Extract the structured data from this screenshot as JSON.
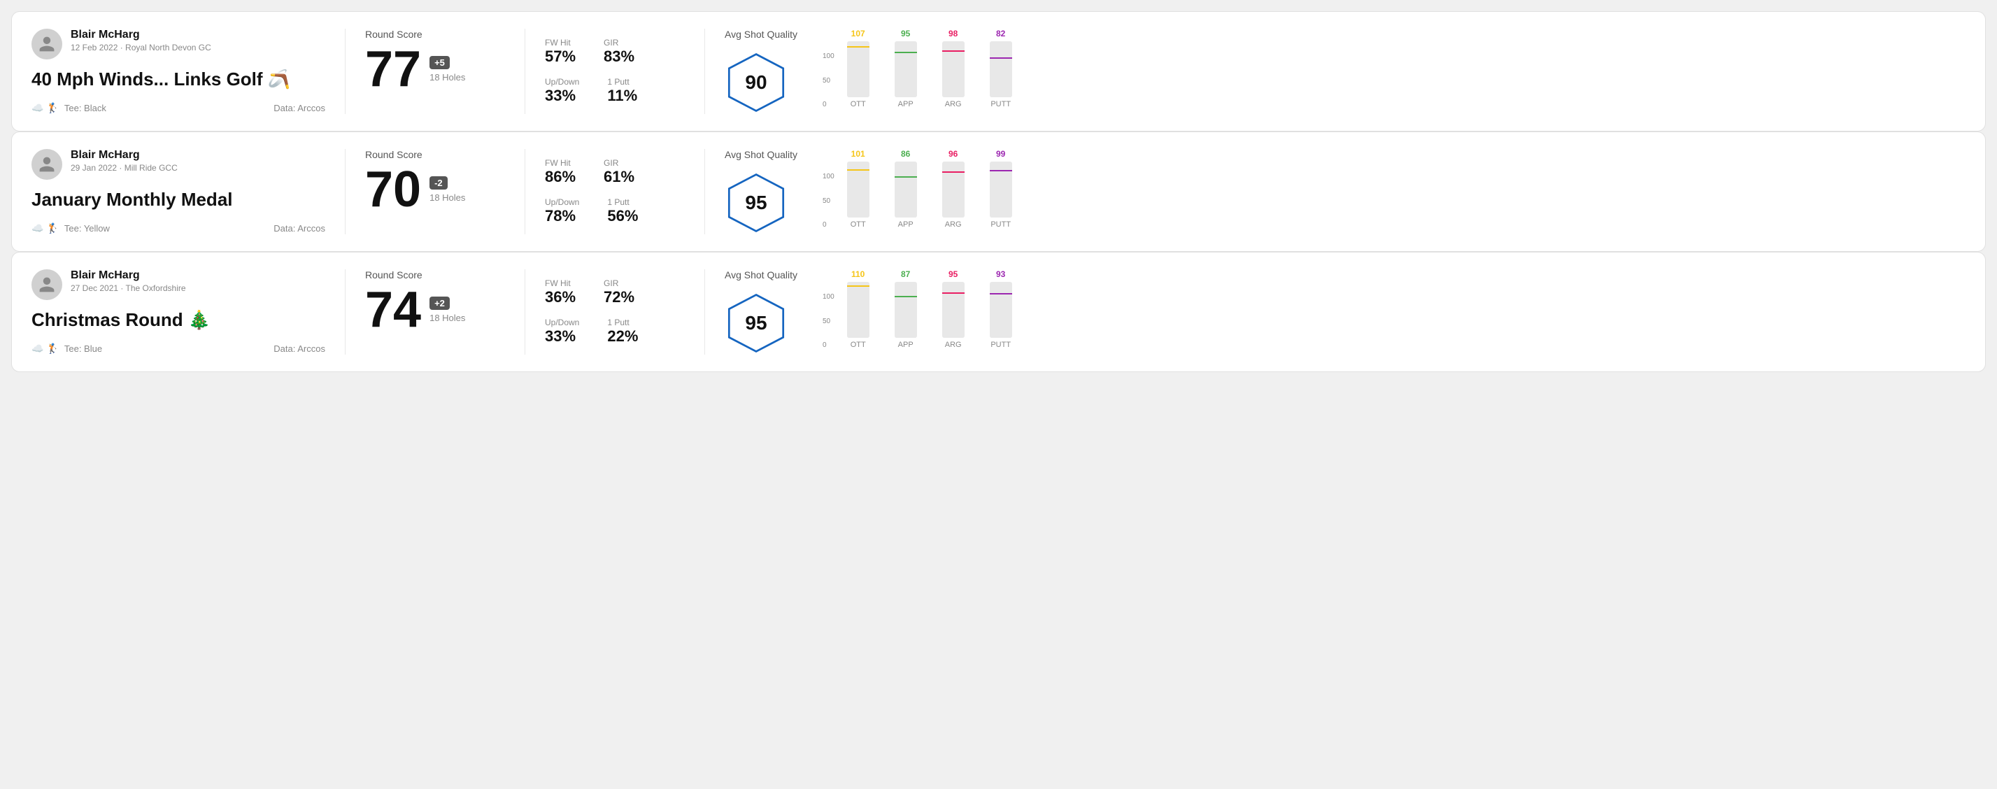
{
  "rounds": [
    {
      "player": "Blair McHarg",
      "date": "12 Feb 2022 · Royal North Devon GC",
      "title": "40 Mph Winds... Links Golf 🪃",
      "tee": "Black",
      "dataSource": "Data: Arccos",
      "score": "77",
      "scoreDiff": "+5",
      "holes": "18 Holes",
      "fwHit": "57%",
      "gir": "83%",
      "upDown": "33%",
      "onePutt": "11%",
      "avgShotQuality": "90",
      "chart": {
        "ott": {
          "value": 107,
          "color": "#f5c518"
        },
        "app": {
          "value": 95,
          "color": "#4caf50"
        },
        "arg": {
          "value": 98,
          "color": "#e91e63"
        },
        "putt": {
          "value": 82,
          "color": "#9c27b0"
        }
      }
    },
    {
      "player": "Blair McHarg",
      "date": "29 Jan 2022 · Mill Ride GCC",
      "title": "January Monthly Medal",
      "tee": "Yellow",
      "dataSource": "Data: Arccos",
      "score": "70",
      "scoreDiff": "-2",
      "holes": "18 Holes",
      "fwHit": "86%",
      "gir": "61%",
      "upDown": "78%",
      "onePutt": "56%",
      "avgShotQuality": "95",
      "chart": {
        "ott": {
          "value": 101,
          "color": "#f5c518"
        },
        "app": {
          "value": 86,
          "color": "#4caf50"
        },
        "arg": {
          "value": 96,
          "color": "#e91e63"
        },
        "putt": {
          "value": 99,
          "color": "#9c27b0"
        }
      }
    },
    {
      "player": "Blair McHarg",
      "date": "27 Dec 2021 · The Oxfordshire",
      "title": "Christmas Round 🎄",
      "tee": "Blue",
      "dataSource": "Data: Arccos",
      "score": "74",
      "scoreDiff": "+2",
      "holes": "18 Holes",
      "fwHit": "36%",
      "gir": "72%",
      "upDown": "33%",
      "onePutt": "22%",
      "avgShotQuality": "95",
      "chart": {
        "ott": {
          "value": 110,
          "color": "#f5c518"
        },
        "app": {
          "value": 87,
          "color": "#4caf50"
        },
        "arg": {
          "value": 95,
          "color": "#e91e63"
        },
        "putt": {
          "value": 93,
          "color": "#9c27b0"
        }
      }
    }
  ],
  "labels": {
    "roundScore": "Round Score",
    "fwHit": "FW Hit",
    "gir": "GIR",
    "upDown": "Up/Down",
    "onePutt": "1 Putt",
    "avgShotQuality": "Avg Shot Quality",
    "ott": "OTT",
    "app": "APP",
    "arg": "ARG",
    "putt": "PUTT",
    "yAxis100": "100",
    "yAxis50": "50",
    "yAxis0": "0"
  }
}
